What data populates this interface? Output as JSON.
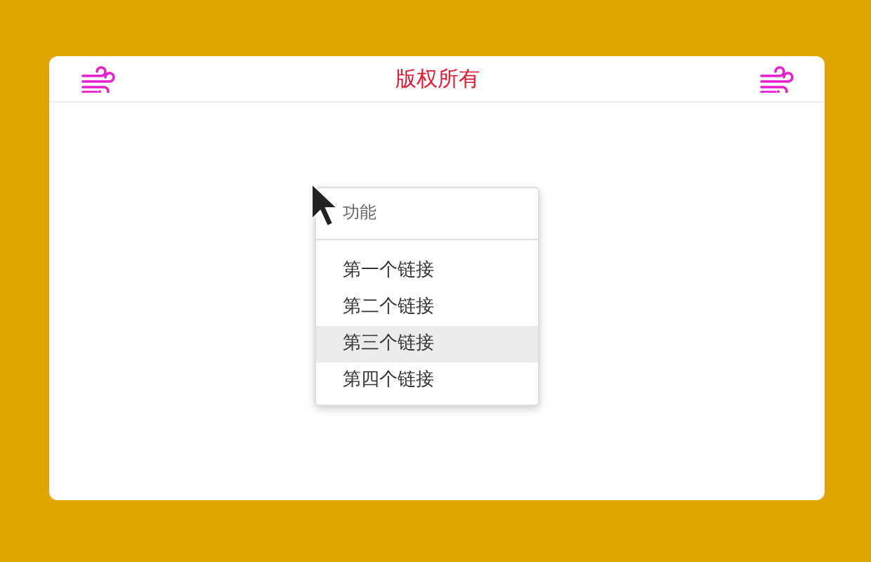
{
  "header": {
    "title": "版权所有"
  },
  "menu": {
    "heading": "功能",
    "items": [
      {
        "label": "第一个链接",
        "selected": false
      },
      {
        "label": "第二个链接",
        "selected": false
      },
      {
        "label": "第三个链接",
        "selected": true
      },
      {
        "label": "第四个链接",
        "selected": false
      }
    ]
  }
}
